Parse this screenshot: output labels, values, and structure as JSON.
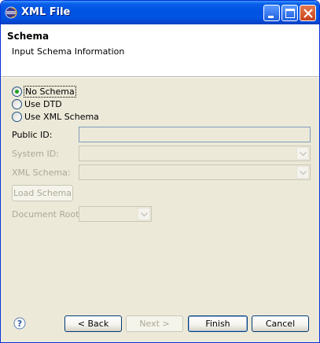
{
  "window": {
    "title": "XML File"
  },
  "banner": {
    "title": "Schema",
    "subtitle": "Input Schema Information"
  },
  "schema_options": {
    "no_schema": "No Schema",
    "use_dtd": "Use DTD",
    "use_xml_schema": "Use XML Schema",
    "selected": "No Schema"
  },
  "form": {
    "public_id_label": "Public ID:",
    "public_id_value": "",
    "system_id_label": "System ID:",
    "system_id_value": "",
    "xml_schema_label": "XML Schema:",
    "xml_schema_value": "",
    "load_schema_label": "Load Schema",
    "document_root_label": "Document Root:",
    "document_root_value": ""
  },
  "footer": {
    "back_label": "< Back",
    "next_label": "Next >",
    "finish_label": "Finish",
    "cancel_label": "Cancel"
  },
  "icons": {
    "window_icon": "eclipse-icon",
    "help": "help-icon",
    "minimize": "minimize-icon",
    "maximize": "maximize-icon",
    "close": "close-icon"
  },
  "colors": {
    "titlebar": "#0054e3",
    "dialog_bg": "#ece9d8",
    "disabled_text": "#aca899",
    "radio_check": "#21a121"
  }
}
